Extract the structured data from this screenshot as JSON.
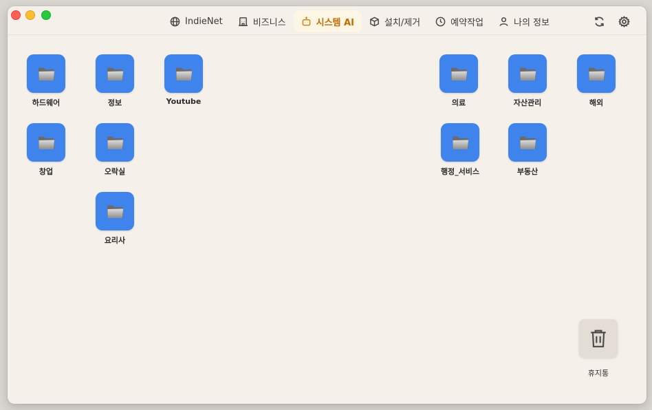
{
  "tabs": [
    {
      "label": "IndieNet",
      "icon": "globe-icon",
      "active": false
    },
    {
      "label": "비즈니스",
      "icon": "building-icon",
      "active": false
    },
    {
      "label": "시스템 AI",
      "icon": "robot-icon",
      "active": true
    },
    {
      "label": "설치/제거",
      "icon": "package-icon",
      "active": false
    },
    {
      "label": "예약작업",
      "icon": "clock-icon",
      "active": false
    },
    {
      "label": "나의 정보",
      "icon": "user-icon",
      "active": false
    }
  ],
  "toolbar": {
    "refresh_icon": "refresh-icon",
    "settings_icon": "gear-icon"
  },
  "colors": {
    "accent": "#c26a00",
    "folder": "#3f83ec",
    "background": "#f5f0ea"
  },
  "folders": {
    "hardware": "하드웨어",
    "info": "정보",
    "youtube": "Youtube",
    "startup": "창업",
    "recreation": "오락실",
    "cooking": "요리사",
    "medical": "의료",
    "asset": "자산관리",
    "overseas": "해외",
    "admin": "행정_서비스",
    "realestate": "부동산"
  },
  "trash": {
    "label": "휴지통"
  }
}
